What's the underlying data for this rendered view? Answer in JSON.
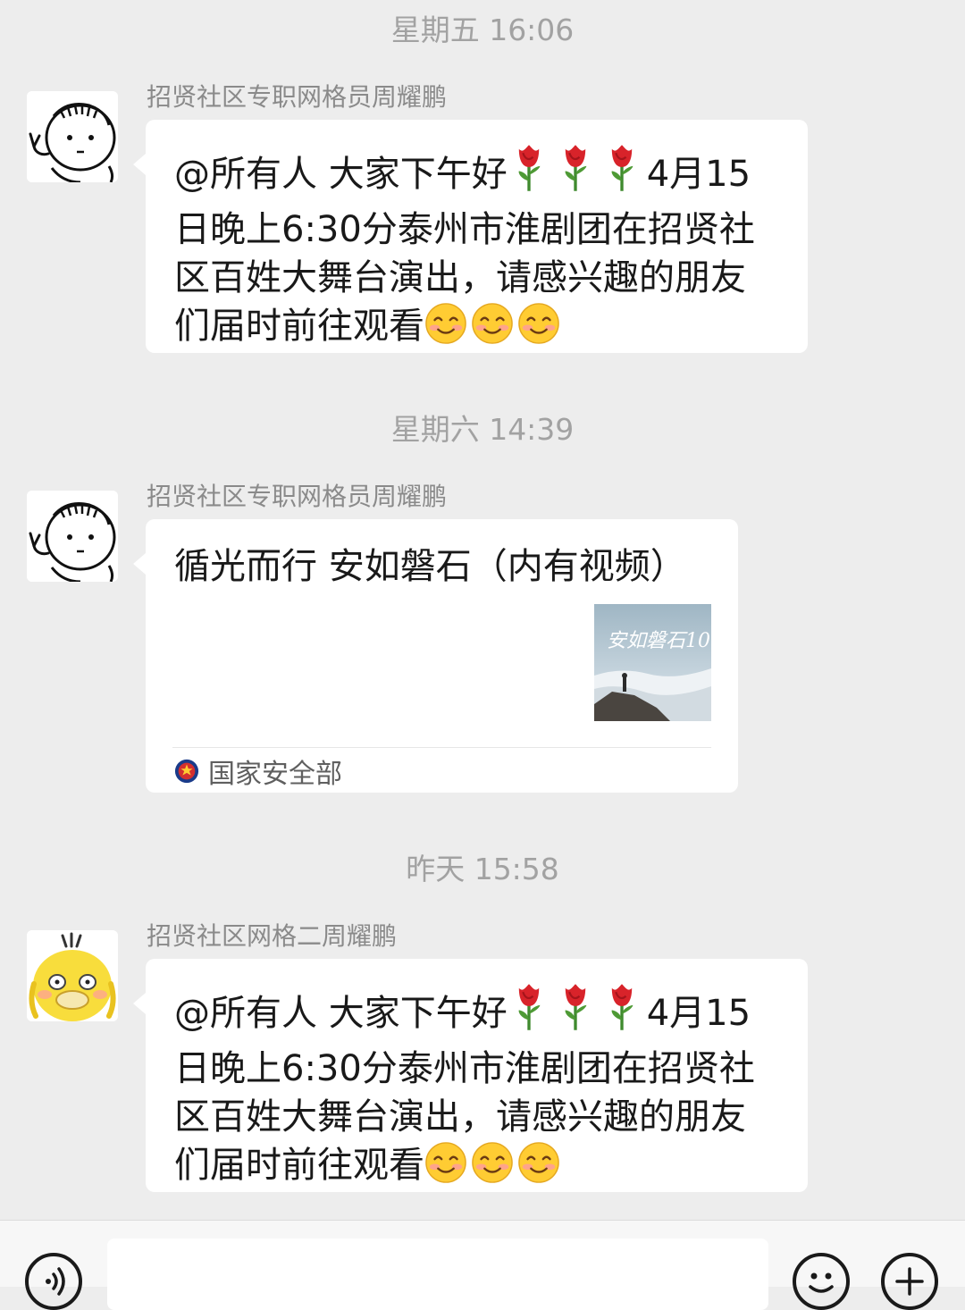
{
  "messages": [
    {
      "timestamp": "星期五 16:06",
      "sender": "招贤社区专职网格员周耀鹏",
      "avatar": "stick-figure-avatar",
      "line1_prefix": "@所有人 大家下午好",
      "line1_suffix": "4月15",
      "body_rest": "日晚上6:30分泰州市淮剧团在招贤社区百姓大舞台演出，请感兴趣的朋友们届时前往观看",
      "icons": [
        "rose-emoji",
        "smile-emoji"
      ]
    },
    {
      "timestamp": "星期六 14:39",
      "sender": "招贤社区专职网格员周耀鹏",
      "avatar": "stick-figure-avatar",
      "card": {
        "title": "循光而行 安如磐石（内有视频）",
        "thumbnail_text": "安如磐石10",
        "source": "国家安全部",
        "source_icon": "national-emblem-icon"
      }
    },
    {
      "timestamp": "昨天 15:58",
      "sender": "招贤社区网格二周耀鹏",
      "avatar": "yellow-duck-avatar",
      "line1_prefix": "@所有人 大家下午好",
      "line1_suffix": "4月15",
      "body_rest": "日晚上6:30分泰州市淮剧团在招贤社区百姓大舞台演出，请感兴趣的朋友们届时前往观看",
      "icons": [
        "rose-emoji",
        "smile-emoji"
      ]
    }
  ],
  "input_bar": {
    "voice_icon": "voice-icon",
    "emoji_icon": "emoji-icon",
    "plus_icon": "plus-icon"
  }
}
